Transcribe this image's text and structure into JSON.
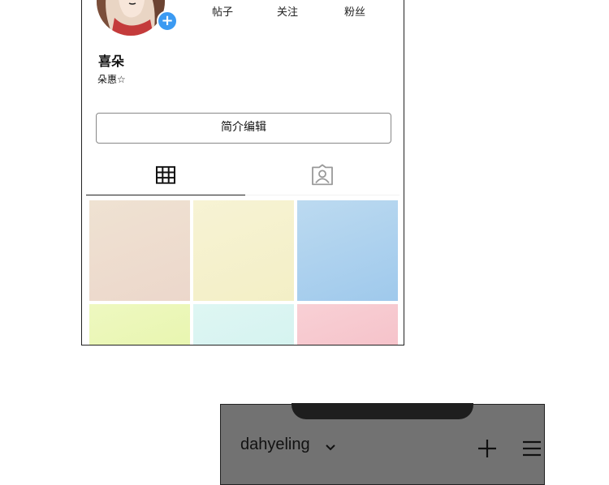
{
  "profile": {
    "stats": [
      "帖子",
      "关注",
      "粉丝"
    ],
    "name": "喜朵",
    "bio": "朵惠☆",
    "edit_button": "简介编辑",
    "add_icon": "plus-circle-icon",
    "tabs": [
      {
        "icon": "grid-icon",
        "active": true
      },
      {
        "icon": "tagged-person-icon",
        "active": false
      }
    ],
    "grid_colors": [
      [
        "#ecd7cb",
        "#efe2d2"
      ],
      [
        "#f3efc6",
        "#f7f3d4"
      ],
      [
        "#9fc9ec",
        "#bcdaf0"
      ],
      [
        "#e4f4a4",
        "#eef8c0"
      ],
      [
        "#cff1ee",
        "#def6f3"
      ],
      [
        "#f4b9c2",
        "#f8d0d5"
      ]
    ],
    "accent": "#3b9af2"
  },
  "header2": {
    "account": "dahyeling",
    "icons": [
      "chevron-down-icon",
      "plus-icon",
      "menu-icon"
    ]
  }
}
